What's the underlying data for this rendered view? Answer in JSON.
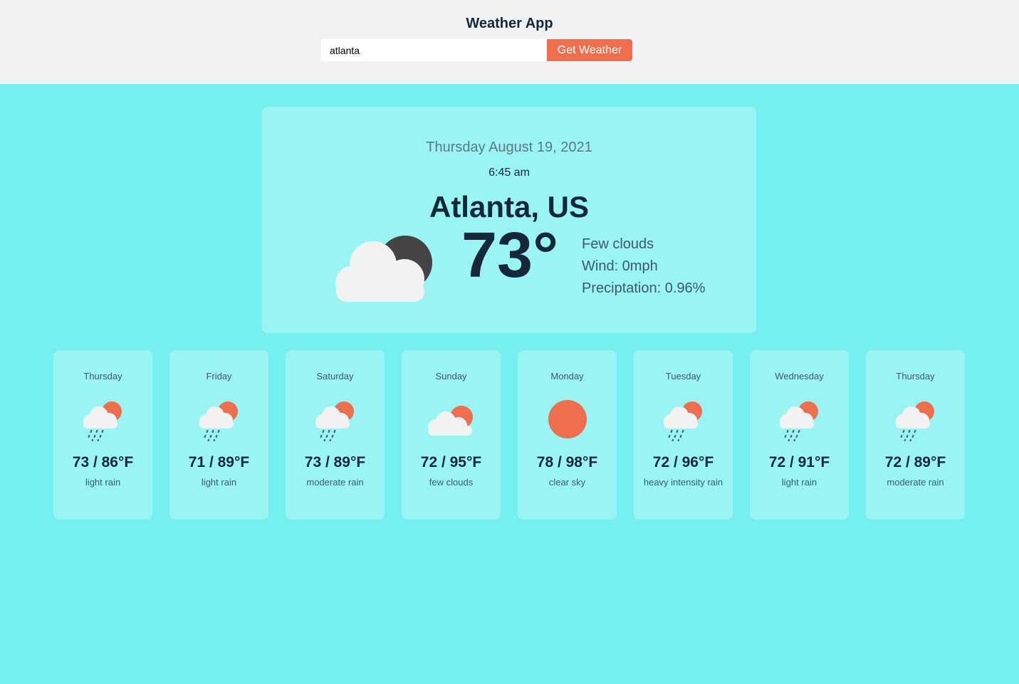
{
  "header": {
    "title": "Weather App",
    "search_value": "atlanta",
    "button_label": "Get Weather"
  },
  "current": {
    "date": "Thursday August 19, 2021",
    "time": "6:45 am",
    "location": "Atlanta, US",
    "temperature": "73°",
    "icon": "cloud-moon-icon",
    "condition": "Few clouds",
    "wind": "Wind: 0mph",
    "precipitation": "Preciptation: 0.96%"
  },
  "forecast": [
    {
      "day": "Thursday",
      "temp": "73 / 86°F",
      "desc": "light rain",
      "icon": "rain-sun-icon"
    },
    {
      "day": "Friday",
      "temp": "71 / 89°F",
      "desc": "light rain",
      "icon": "rain-sun-icon"
    },
    {
      "day": "Saturday",
      "temp": "73 / 89°F",
      "desc": "moderate rain",
      "icon": "rain-sun-icon"
    },
    {
      "day": "Sunday",
      "temp": "72 / 95°F",
      "desc": "few clouds",
      "icon": "cloud-sun-icon"
    },
    {
      "day": "Monday",
      "temp": "78 / 98°F",
      "desc": "clear sky",
      "icon": "sun-icon"
    },
    {
      "day": "Tuesday",
      "temp": "72 / 96°F",
      "desc": "heavy intensity rain",
      "icon": "rain-sun-icon"
    },
    {
      "day": "Wednesday",
      "temp": "72 / 91°F",
      "desc": "light rain",
      "icon": "rain-sun-icon"
    },
    {
      "day": "Thursday",
      "temp": "72 / 89°F",
      "desc": "moderate rain",
      "icon": "rain-sun-icon"
    }
  ],
  "colors": {
    "page_bg": "#75eff0",
    "card_bg": "#9af4f4",
    "accent": "#ee6e4e",
    "header_bg": "#f2f2f2",
    "text_dark": "#14283a"
  }
}
